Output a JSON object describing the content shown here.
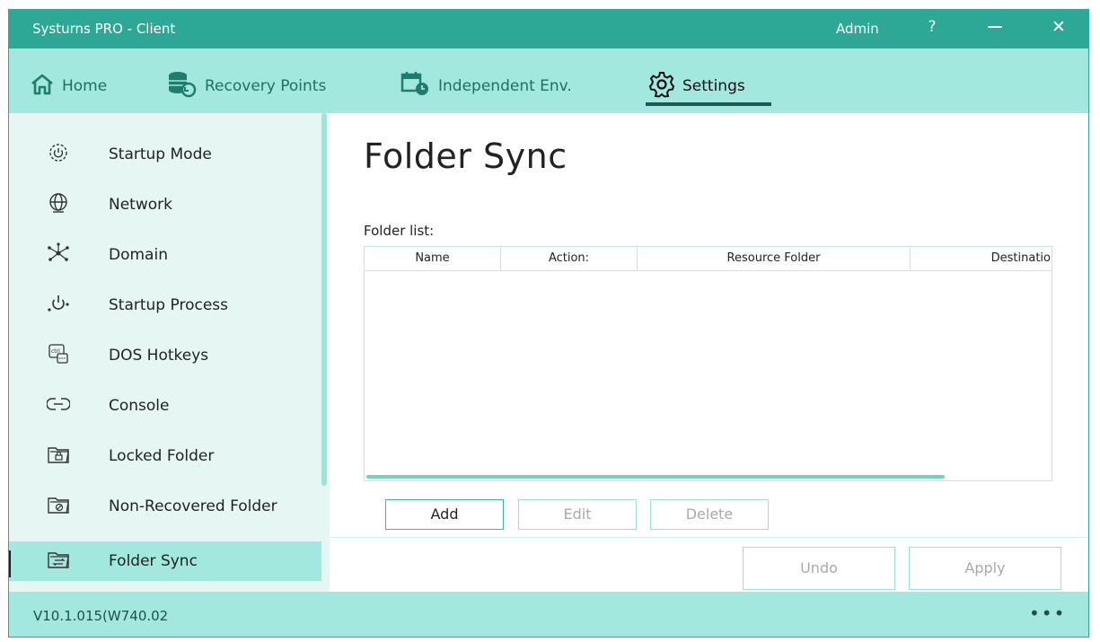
{
  "window": {
    "title": "Systurns PRO - Client",
    "user": "Admin",
    "help_label": "?",
    "close_label": "✕"
  },
  "tabs": [
    {
      "label": "Home",
      "icon": "home-icon"
    },
    {
      "label": "Recovery Points",
      "icon": "database-restore-icon"
    },
    {
      "label": "Independent Env.",
      "icon": "calendar-clock-icon"
    },
    {
      "label": "Settings",
      "icon": "gear-icon",
      "active": true
    }
  ],
  "sidebar": {
    "items": [
      {
        "label": "Startup Mode",
        "icon": "power-gear-icon"
      },
      {
        "label": "Network",
        "icon": "globe-network-icon"
      },
      {
        "label": "Domain",
        "icon": "domain-nodes-icon"
      },
      {
        "label": "Startup Process",
        "icon": "power-process-icon"
      },
      {
        "label": "DOS Hotkeys",
        "icon": "ctrl-key-icon"
      },
      {
        "label": "Console",
        "icon": "link-console-icon"
      },
      {
        "label": "Locked Folder",
        "icon": "locked-folder-icon"
      },
      {
        "label": "Non-Recovered Folder",
        "icon": "non-recovered-folder-icon"
      },
      {
        "label": "Folder Sync",
        "icon": "folder-sync-icon",
        "active": true
      }
    ]
  },
  "main": {
    "title": "Folder Sync",
    "folder_list_label": "Folder list:",
    "columns": [
      "Name",
      "Action:",
      "Resource Folder",
      "Destinatio"
    ],
    "buttons": {
      "add": "Add",
      "edit": "Edit",
      "delete": "Delete",
      "undo": "Undo",
      "apply": "Apply"
    }
  },
  "status": {
    "version": "V10.1.015(W740.02",
    "more_label": "•••"
  },
  "colors": {
    "accent": "#2ea896",
    "tab_bg": "#a3e8de",
    "sidebar_bg": "#e6f6f2"
  }
}
